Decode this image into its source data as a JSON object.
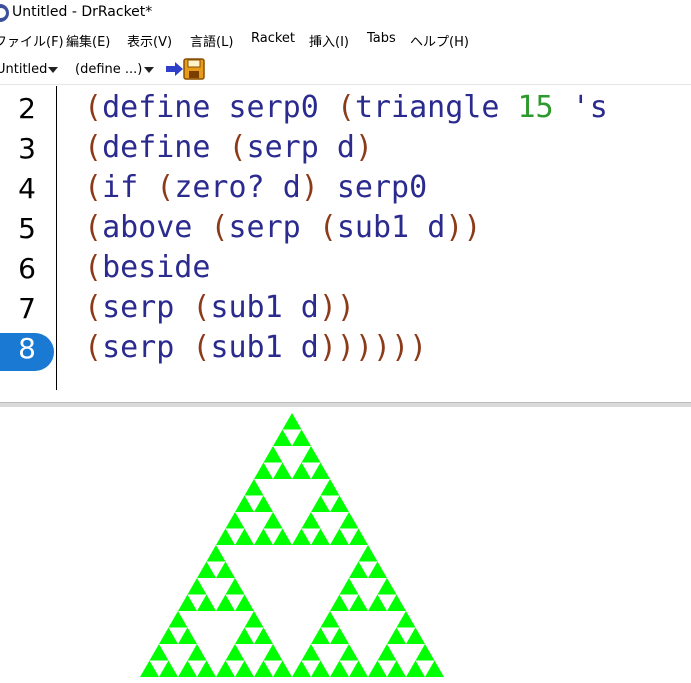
{
  "window": {
    "title": "Untitled - DrRacket*"
  },
  "menubar": [
    {
      "id": "file",
      "label": "ファイル(F)"
    },
    {
      "id": "edit",
      "label": "編集(E)"
    },
    {
      "id": "view",
      "label": "表示(V)"
    },
    {
      "id": "language",
      "label": "言語(L)"
    },
    {
      "id": "racket",
      "label": "Racket"
    },
    {
      "id": "insert",
      "label": "挿入(I)"
    },
    {
      "id": "tabs",
      "label": "Tabs"
    },
    {
      "id": "help",
      "label": "ヘルプ(H)"
    }
  ],
  "toolbar": {
    "file_label": "Untitled",
    "define_label": "(define ...)",
    "save_icon": "save-icon",
    "arrow_icon": "arrow-right-icon"
  },
  "editor": {
    "active_line": "8",
    "lines": [
      {
        "num": "2",
        "text": "(define serp0 (triangle 15 's"
      },
      {
        "num": "3",
        "text": "(define (serp d)"
      },
      {
        "num": "4",
        "text": "(if (zero? d) serp0"
      },
      {
        "num": "5",
        "text": "(above (serp (sub1 d))"
      },
      {
        "num": "6",
        "text": "(beside"
      },
      {
        "num": "7",
        "text": "(serp (sub1 d))"
      },
      {
        "num": "8",
        "text": "(serp (sub1 d))))))"
      }
    ]
  },
  "output": {
    "fill_color": "#00ff00",
    "depth": 4
  }
}
